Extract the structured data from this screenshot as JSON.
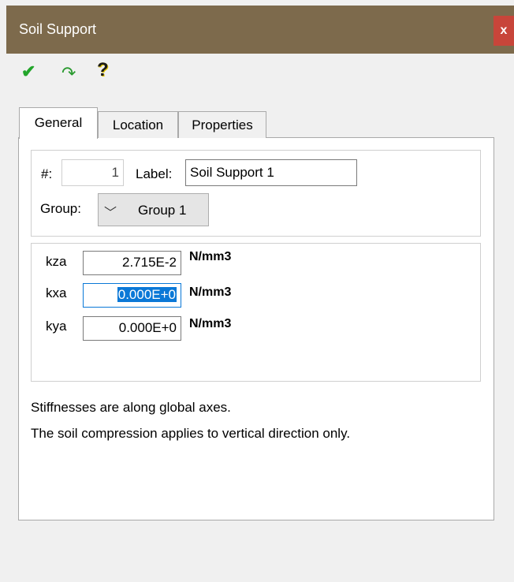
{
  "window": {
    "title": "Soil Support",
    "close_label": "x"
  },
  "toolbar": {
    "check_icon": "check-icon",
    "redo_icon": "redo-icon",
    "help_icon": "help-icon"
  },
  "tabs": [
    {
      "label": "General",
      "active": true
    },
    {
      "label": "Location",
      "active": false
    },
    {
      "label": "Properties",
      "active": false
    }
  ],
  "general": {
    "number_label": "#:",
    "number_value": "1",
    "label_label": "Label:",
    "label_value": "Soil Support 1",
    "group_label": "Group:",
    "group_value": "Group 1"
  },
  "stiffness": [
    {
      "name": "kza",
      "value": "2.715E-2",
      "unit": "N/mm3",
      "selected": false
    },
    {
      "name": "kxa",
      "value": "0.000E+0",
      "unit": "N/mm3",
      "selected": true
    },
    {
      "name": "kya",
      "value": "0.000E+0",
      "unit": "N/mm3",
      "selected": false
    }
  ],
  "notes": [
    "Stiffnesses are along global axes.",
    "The soil compression applies to vertical direction only."
  ],
  "colors": {
    "titlebar": "#7d6a4c",
    "close": "#c8453a",
    "selection": "#0a78d7"
  }
}
